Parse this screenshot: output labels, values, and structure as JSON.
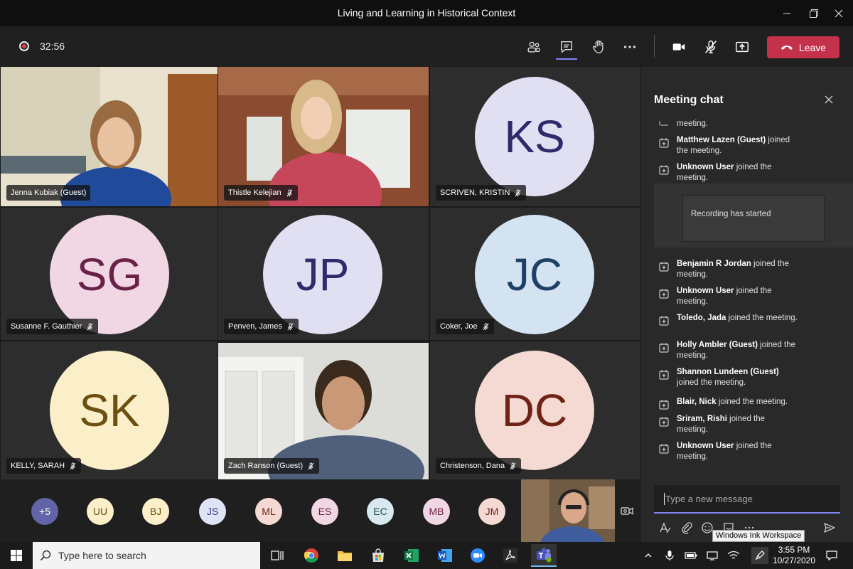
{
  "window": {
    "title": "Living and Learning in Historical Context"
  },
  "toolbar": {
    "timer": "32:56",
    "leave_label": "Leave"
  },
  "tiles": [
    {
      "name": "Jenna Kubiak (Guest)",
      "type": "video"
    },
    {
      "name": "Thistle Kelejian",
      "type": "video"
    },
    {
      "name": "SCRIVEN, KRISTIN",
      "initials": "KS",
      "bg": "#e1dff2",
      "fg": "#2e2a6b"
    },
    {
      "name": "Susanne F. Gauthier",
      "initials": "SG",
      "bg": "#f1d6e4",
      "fg": "#6b2248"
    },
    {
      "name": "Penven, James",
      "initials": "JP",
      "bg": "#e1dff2",
      "fg": "#2e2a6b"
    },
    {
      "name": "Coker, Joe",
      "initials": "JC",
      "bg": "#d4e3f1",
      "fg": "#1e3f66"
    },
    {
      "name": "KELLY, SARAH",
      "initials": "SK",
      "bg": "#fbefca",
      "fg": "#6b5011"
    },
    {
      "name": "Zach Ranson (Guest)",
      "type": "video"
    },
    {
      "name": "Christenson, Dana",
      "initials": "DC",
      "bg": "#f5d9d3",
      "fg": "#6f2315"
    }
  ],
  "roster": [
    {
      "initials": "+5",
      "bg": "#6264a7",
      "fg": "#ffffff"
    },
    {
      "initials": "UU",
      "bg": "#fbefca",
      "fg": "#6b5011"
    },
    {
      "initials": "BJ",
      "bg": "#fbefca",
      "fg": "#6b5011"
    },
    {
      "initials": "JS",
      "bg": "#dfe3f6",
      "fg": "#2e3a7a"
    },
    {
      "initials": "ML",
      "bg": "#f5d9d3",
      "fg": "#6f2315"
    },
    {
      "initials": "ES",
      "bg": "#f1d6e4",
      "fg": "#6b2248"
    },
    {
      "initials": "EC",
      "bg": "#d8e8ee",
      "fg": "#1e4d5c"
    },
    {
      "initials": "MB",
      "bg": "#f1d6e4",
      "fg": "#6b2248"
    },
    {
      "initials": "JM",
      "bg": "#f5d9d3",
      "fg": "#6f2315"
    }
  ],
  "chat": {
    "title": "Meeting chat",
    "partial_top": "meeting.",
    "messages_a": [
      {
        "name": "Matthew Lazen (Guest)",
        "rest": " joined the meeting."
      },
      {
        "name": "Unknown User",
        "rest": " joined the meeting."
      }
    ],
    "recording_text": "Recording has started",
    "messages_b": [
      {
        "name": "Benjamin R Jordan",
        "rest": " joined the meeting."
      },
      {
        "name": "Unknown User",
        "rest": " joined the meeting."
      },
      {
        "name": "Toledo, Jada",
        "rest": " joined the meeting."
      },
      {
        "name": "Holly Ambler (Guest)",
        "rest": " joined the meeting."
      },
      {
        "name": "Shannon Lundeen (Guest)",
        "rest": " joined the meeting."
      },
      {
        "name": "Blair, Nick",
        "rest": " joined the meeting."
      },
      {
        "name": "Sriram, Rishi",
        "rest": " joined the meeting."
      },
      {
        "name": "Unknown User",
        "rest": " joined the meeting."
      }
    ],
    "compose_placeholder": "Type a new message",
    "tooltip": "Windows Ink Workspace"
  },
  "taskbar": {
    "search_placeholder": "Type here to search",
    "time": "3:55 PM",
    "date": "10/27/2020"
  }
}
